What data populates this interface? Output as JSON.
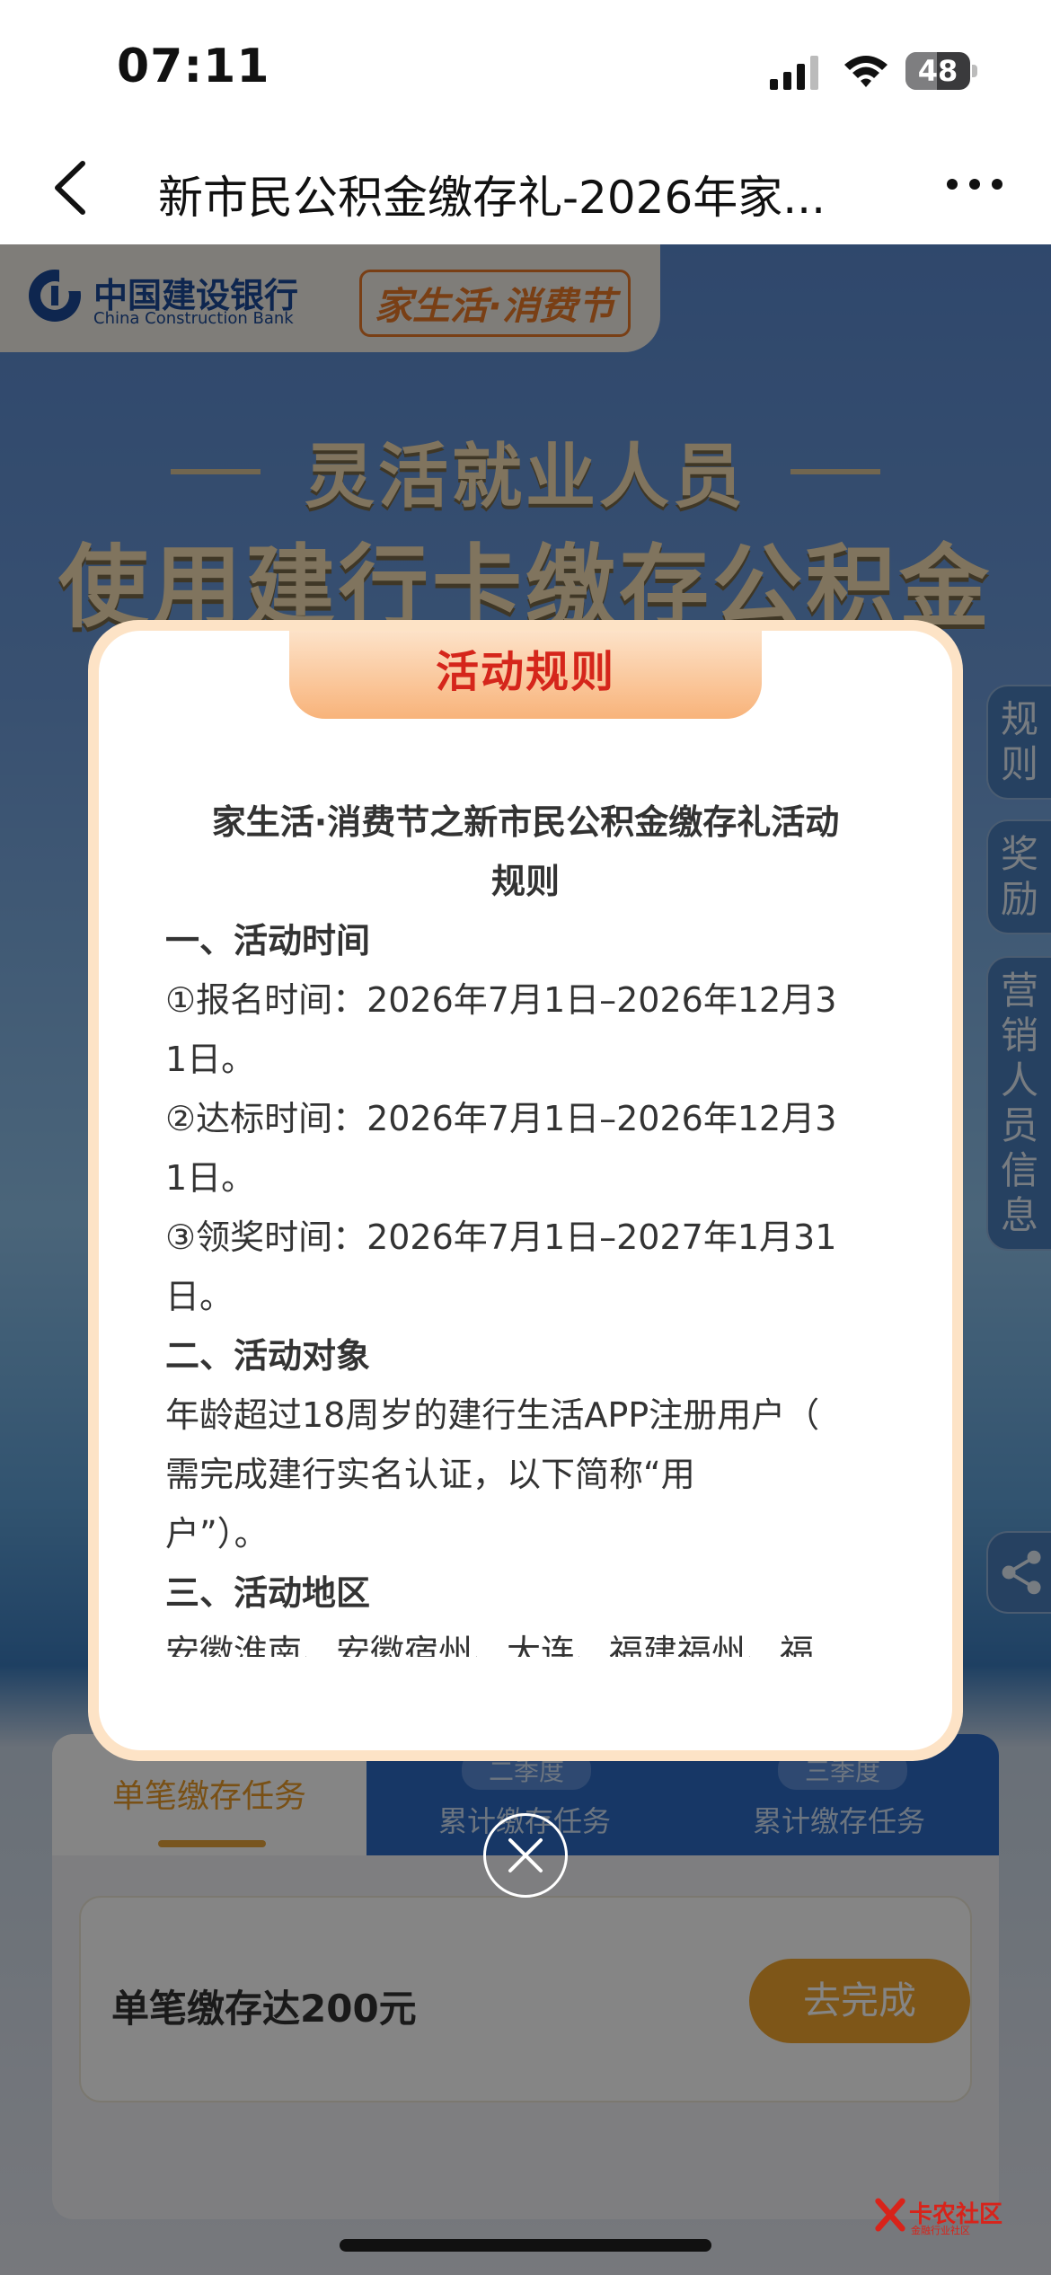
{
  "status": {
    "time": "07:11",
    "battery": "48",
    "battery_level": 0.48
  },
  "nav": {
    "title": "新市民公积金缴存礼-2026年家..."
  },
  "brand": {
    "bank_name": "中国建设银行",
    "bank_name_en": "China Construction Bank",
    "festival": "家生活·消费节"
  },
  "hero": {
    "subtitle": "灵活就业人员",
    "title": "使用建行卡缴存公积金"
  },
  "side_tabs": {
    "rules": "规则",
    "reward": "奖励",
    "marketing": "营销人员信息"
  },
  "tasks": {
    "tab_active": "单笔缴存任务",
    "tab2_badge": "二季度",
    "tab2_label": "累计缴存任务",
    "tab3_badge": "三季度",
    "tab3_label": "累计缴存任务",
    "row_label": "单笔缴存达200元",
    "row_button": "去完成"
  },
  "dialog": {
    "title": "活动规则",
    "heading_l1": "家生活·消费节之新市民公积金缴存礼活动",
    "heading_l2": "规则",
    "lines": [
      "一、活动时间",
      "①报名时间：2026年7月1日–2026年12月3",
      "1日。",
      "②达标时间：2026年7月1日–2026年12月3",
      "1日。",
      "③领奖时间：2026年7月1日–2027年1月31",
      "日。",
      "二、活动对象",
      "年龄超过18周岁的建行生活APP注册用户（",
      "需完成建行实名认证，以下简称“用",
      "户”）。",
      "三、活动地区",
      "安徽淮南、安徽宿州、大连、福建福州、福"
    ]
  },
  "watermark": {
    "text": "卡农社区",
    "sub": "金融行业社区"
  },
  "colors": {
    "accent_red": "#d5261b",
    "accent_orange": "#f1a52e",
    "brand_blue": "#1b4a97"
  }
}
